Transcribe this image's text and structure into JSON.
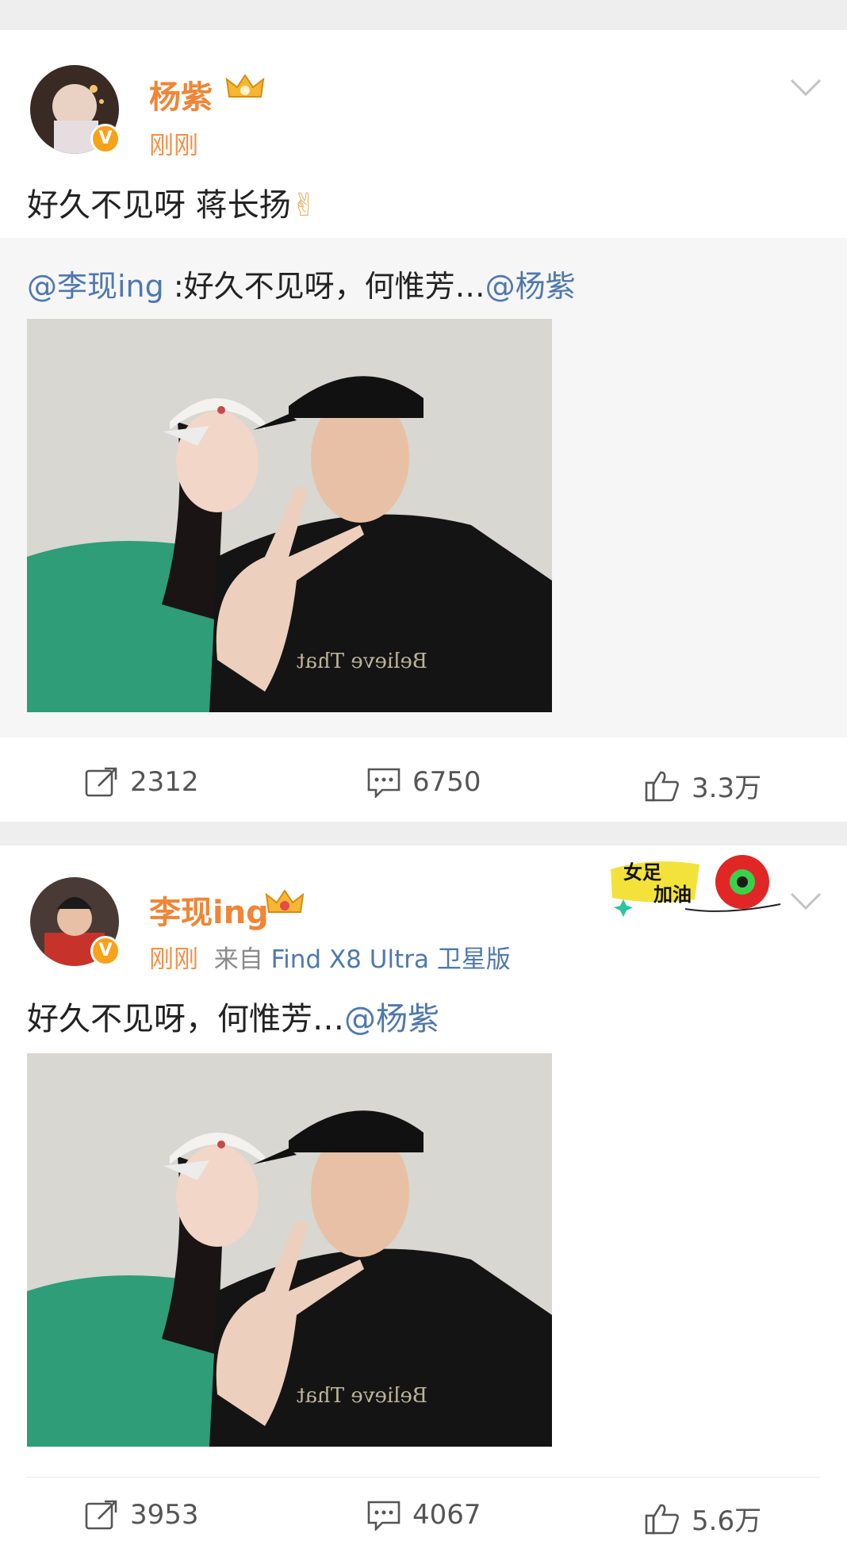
{
  "posts": [
    {
      "author": "杨紫",
      "time": "刚刚",
      "text": "好久不见呀 蒋长扬",
      "text_emoji": "✌",
      "quote": {
        "author_mention": "@李现ing",
        "sep": " :",
        "text": "好久不见呀，何惟芳…",
        "mention": "@杨紫"
      },
      "actions": {
        "repost": "2312",
        "comment": "6750",
        "like": "3.3万"
      }
    },
    {
      "author": "李现ing",
      "time": "刚刚",
      "source_label": "来自",
      "source": "Find X8 Ultra 卫星版",
      "text": "好久不见呀，何惟芳…",
      "mention": "@杨紫",
      "sticker_line1": "女足",
      "sticker_line2": "加油",
      "actions": {
        "repost": "3953",
        "comment": "4067",
        "like": "5.6万"
      }
    }
  ],
  "photo_shirt_text": "Believe That",
  "colors": {
    "name": "#f08535",
    "link": "#4f78ad",
    "badge": "#f7a21b"
  }
}
